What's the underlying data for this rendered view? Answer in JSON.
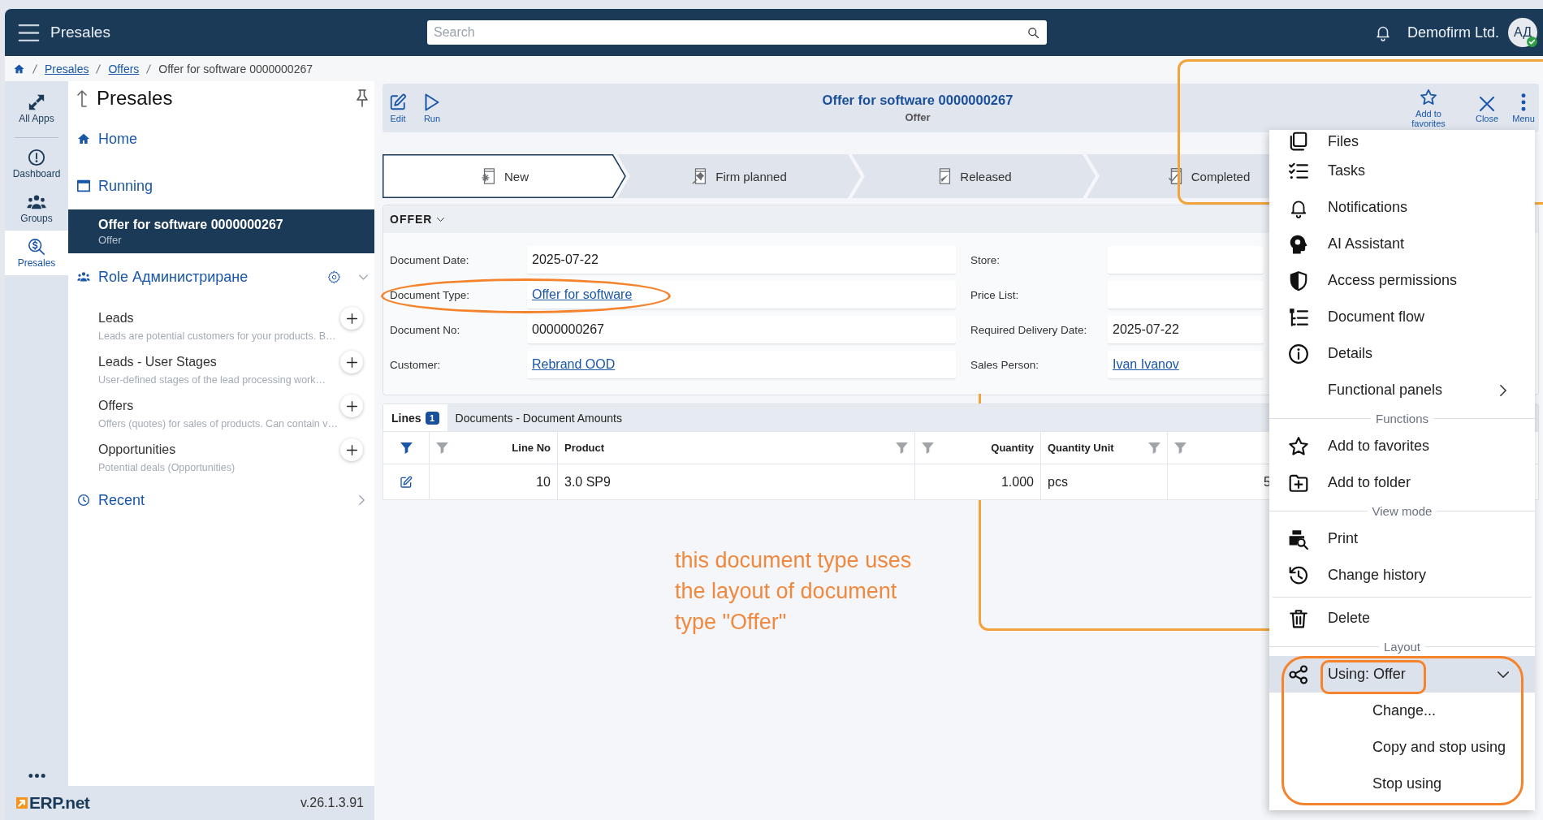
{
  "header": {
    "app_title": "Presales",
    "search": {
      "placeholder": "Search"
    },
    "company": "Demofirm Ltd.",
    "avatar": {
      "initials": "АД",
      "verified": true
    }
  },
  "breadcrumb": [
    {
      "label": "Presales",
      "link": true
    },
    {
      "label": "Offers",
      "link": true
    },
    {
      "label": "Offer for software 0000000267",
      "link": false
    }
  ],
  "rail": [
    {
      "label": "All Apps",
      "selected": false
    },
    {
      "label": "Dashboard",
      "selected": false
    },
    {
      "label": "Groups",
      "selected": false
    },
    {
      "label": "Presales",
      "selected": true
    }
  ],
  "nav": {
    "title": "Presales",
    "home": "Home",
    "running": {
      "label": "Running",
      "items": [
        {
          "title": "Offer for software 0000000267",
          "subtitle": "Offer",
          "selected": true
        }
      ]
    },
    "role": {
      "label": "Role Администриране",
      "expanded": true,
      "items": [
        {
          "title": "Leads",
          "description": "Leads are potential customers for your products. B…"
        },
        {
          "title": "Leads - User Stages",
          "description": "User-defined stages of the lead processing work…"
        },
        {
          "title": "Offers",
          "description": "Offers (quotes) for sales of products. Can contain v…"
        },
        {
          "title": "Opportunities",
          "description": "Potential deals (Opportunities)"
        }
      ]
    },
    "recent": "Recent"
  },
  "footer": {
    "logo": "ERP.net",
    "version": "v.26.1.3.91"
  },
  "document": {
    "title": "Offer for software 0000000267",
    "subtitle": "Offer"
  },
  "toolbar": {
    "left": [
      "Edit",
      "Run"
    ],
    "right": [
      "Add to favorites",
      "Close",
      "Menu"
    ]
  },
  "stages": [
    {
      "label": "New",
      "selected": true
    },
    {
      "label": "Firm planned",
      "selected": false
    },
    {
      "label": "Released",
      "selected": false
    },
    {
      "label": "Completed",
      "selected": false
    }
  ],
  "section": {
    "title": "OFFER",
    "expanded": true
  },
  "fields": {
    "left": [
      {
        "label": "Document Date:",
        "value": "2025-07-22",
        "link": false
      },
      {
        "label": "Document Type:",
        "value": "Offer for software",
        "link": true
      },
      {
        "label": "Document No:",
        "value": "0000000267",
        "link": false
      },
      {
        "label": "Customer:",
        "value": "Rebrand OOD",
        "link": true
      }
    ],
    "right": [
      {
        "label": "Store:"
      },
      {
        "label": "Price List:"
      },
      {
        "label": "Required Delivery Date:",
        "value": "2025-07-22",
        "link": false
      },
      {
        "label": "Sales Person:",
        "value": "Ivan Ivanov",
        "link": true
      }
    ]
  },
  "detail_tabs": [
    {
      "label": "Lines",
      "count": "1",
      "selected": true
    },
    {
      "label": "Documents - Document Amounts",
      "selected": false
    }
  ],
  "table": {
    "columns": [
      {
        "kind": "number",
        "label": "Line No"
      },
      {
        "kind": "text",
        "label": "Product"
      },
      {
        "kind": "number",
        "label": "Quantity"
      },
      {
        "kind": "text",
        "label": "Quantity Unit"
      },
      {
        "kind": "number"
      }
    ],
    "rows": [
      {
        "cells": [
          "10",
          "3.0 SP9",
          "1.000",
          "pcs",
          "5"
        ]
      }
    ]
  },
  "note": "this document type uses the layout of document type \"Offer\"",
  "menu": {
    "groups": [
      {
        "items": [
          {
            "label": "Files",
            "submenu": false
          },
          {
            "label": "Tasks",
            "submenu": false
          },
          {
            "label": "Notifications",
            "submenu": false
          },
          {
            "label": "AI Assistant",
            "submenu": false
          },
          {
            "label": "Access permissions",
            "submenu": false
          },
          {
            "label": "Document flow",
            "submenu": false
          },
          {
            "label": "Details",
            "submenu": false
          },
          {
            "label": "Functional panels",
            "submenu": true
          }
        ]
      },
      {
        "heading": "Functions",
        "items": [
          {
            "label": "Add to favorites"
          },
          {
            "label": "Add to folder"
          }
        ]
      },
      {
        "heading": "View mode",
        "items": [
          {
            "label": "Print"
          },
          {
            "label": "Change history"
          }
        ]
      },
      {
        "items": [
          {
            "label": "Delete"
          }
        ]
      },
      {
        "heading": "Layout",
        "items": [
          {
            "label": "Using: Offer",
            "selected": true,
            "expanded": true,
            "children": [
              {
                "label": "Change..."
              },
              {
                "label": "Copy and stop using"
              },
              {
                "label": "Stop using"
              }
            ]
          }
        ]
      }
    ]
  }
}
